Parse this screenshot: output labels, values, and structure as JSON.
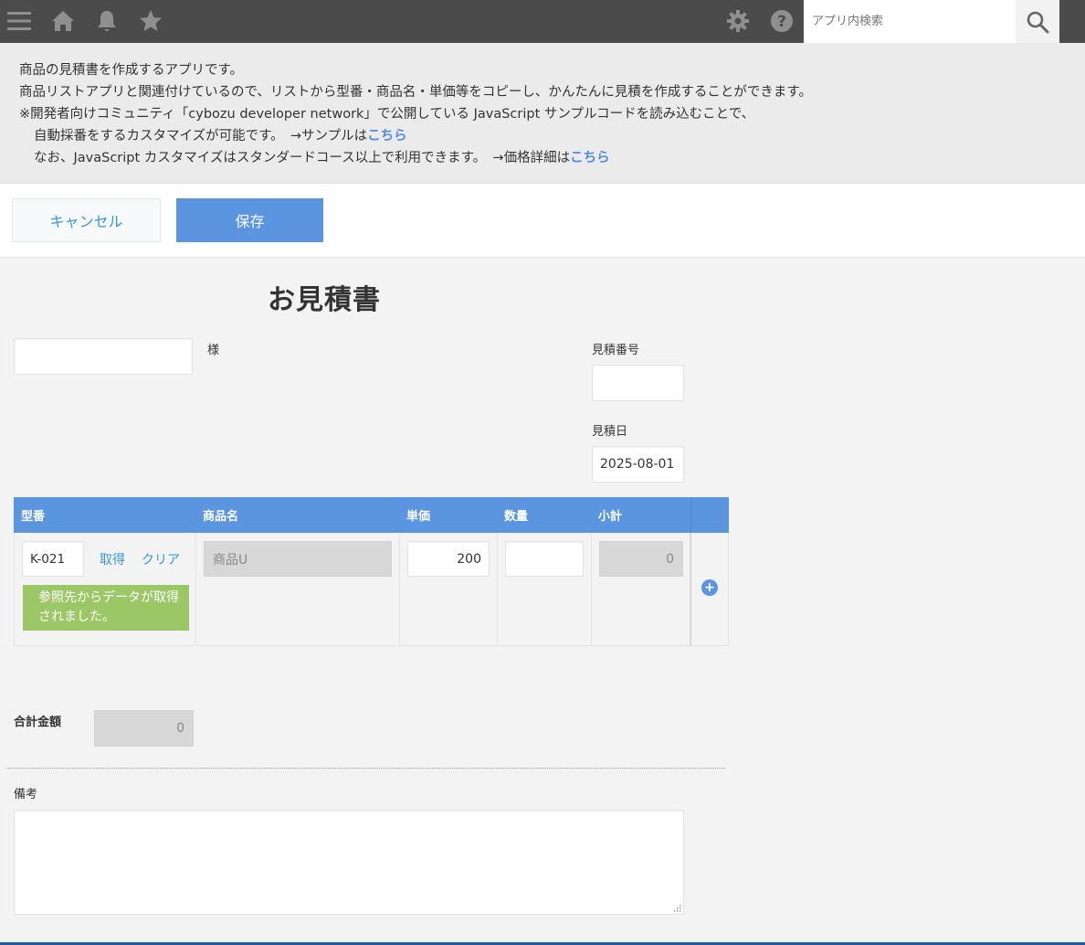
{
  "topbar": {
    "search_placeholder": "アプリ内検索",
    "icons": [
      "menu-icon",
      "home-icon",
      "bell-icon",
      "star-icon",
      "gear-icon",
      "help-icon",
      "search-icon"
    ]
  },
  "description": {
    "line1": "商品の見積書を作成するアプリです。",
    "line2": "商品リストアプリと関連付けているので、リストから型番・商品名・単価等をコピーし、かんたんに見積を作成することができます。",
    "line3": "※開発者向けコミュニティ「cybozu developer network」で公開している JavaScript サンプルコードを読み込むことで、",
    "line4_text": "自動採番をするカスタマイズが可能です。　→サンプルは",
    "line4_link": "こちら",
    "line5_text": "なお、JavaScript カスタマイズはスタンダードコース以上で利用できます。　→価格詳細は",
    "line5_link": "こちら"
  },
  "actions": {
    "cancel_label": "キャンセル",
    "save_label": "保存"
  },
  "form": {
    "title": "お見積書",
    "customer_value": "",
    "customer_suffix": "様",
    "quote_number_label": "見積番号",
    "quote_number_value": "",
    "quote_date_label": "見積日",
    "quote_date_value": "2025-08-01",
    "table": {
      "headers": [
        "型番",
        "商品名",
        "単価",
        "数量",
        "小計"
      ],
      "rows": [
        {
          "model_no": "K-021",
          "fetch_label": "取得",
          "clear_label": "クリア",
          "notice": "参照先からデータが取得されました。",
          "product_name": "商品U",
          "unit_price": "200",
          "quantity": "",
          "subtotal": "0"
        }
      ],
      "add_row_symbol": "+"
    },
    "total_label": "合計金額",
    "total_value": "0",
    "remarks_label": "備考",
    "remarks_value": ""
  },
  "colors": {
    "topbar": "#4b4b4b",
    "accent": "#5b94df",
    "link": "#3498db",
    "notice": "#9cc766"
  }
}
